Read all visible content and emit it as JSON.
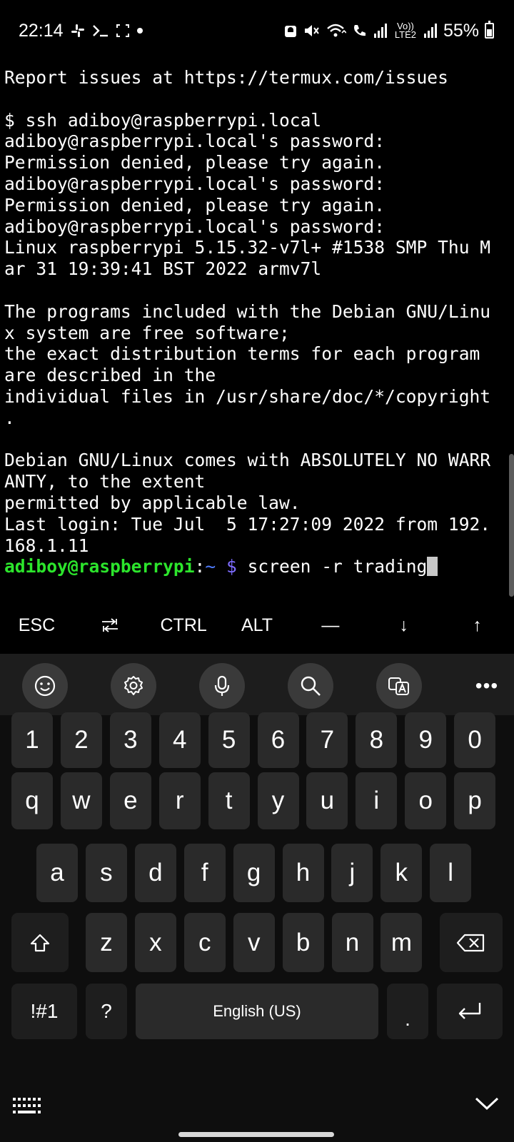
{
  "status_bar": {
    "time": "22:14",
    "left_icons": [
      "slack-icon",
      "terminal-icon",
      "screenshot-icon",
      "dot-icon"
    ],
    "right_icons": [
      "lock-icon",
      "mute-icon",
      "wifi-icon",
      "wifi-calling-icon",
      "signal-icon",
      "signal-icon-2"
    ],
    "volte": "Vo)) LTE2",
    "battery": "55%",
    "battery_level": 0.55
  },
  "terminal": {
    "lines": [
      "Report issues at https://termux.com/issues",
      "",
      "$ ssh adiboy@raspberrypi.local",
      "adiboy@raspberrypi.local's password:",
      "Permission denied, please try again.",
      "adiboy@raspberrypi.local's password:",
      "Permission denied, please try again.",
      "adiboy@raspberrypi.local's password:",
      "Linux raspberrypi 5.15.32-v7l+ #1538 SMP Thu M",
      "ar 31 19:39:41 BST 2022 armv7l",
      "",
      "The programs included with the Debian GNU/Linu",
      "x system are free software;",
      "the exact distribution terms for each program",
      "are described in the",
      "individual files in /usr/share/doc/*/copyright",
      ".",
      "",
      "Debian GNU/Linux comes with ABSOLUTELY NO WARR",
      "ANTY, to the extent",
      "permitted by applicable law.",
      "Last login: Tue Jul  5 17:27:09 2022 from 192.",
      "168.1.11"
    ],
    "prompt_user": "adiboy@raspberrypi",
    "prompt_sep": ":",
    "prompt_path": "~",
    "prompt_symbol": "$",
    "command": "screen -r trading"
  },
  "extra_keys": [
    "ESC",
    "⭾",
    "CTRL",
    "ALT",
    "—",
    "↓",
    "↑"
  ],
  "keyboard": {
    "toolbar_icons": [
      "emoji-icon",
      "settings-icon",
      "microphone-icon",
      "search-icon",
      "translate-icon",
      "more-icon"
    ],
    "more_label": "•••",
    "rows": [
      [
        "1",
        "2",
        "3",
        "4",
        "5",
        "6",
        "7",
        "8",
        "9",
        "0"
      ],
      [
        "q",
        "w",
        "e",
        "r",
        "t",
        "y",
        "u",
        "i",
        "o",
        "p"
      ],
      [
        "a",
        "s",
        "d",
        "f",
        "g",
        "h",
        "j",
        "k",
        "l"
      ],
      [
        "z",
        "x",
        "c",
        "v",
        "b",
        "n",
        "m"
      ]
    ],
    "symbols_label": "!#1",
    "question_label": "?",
    "space_label": "English (US)",
    "period_label": ".",
    "shift_icon": "shift-icon",
    "backspace_icon": "backspace-icon",
    "enter_icon": "enter-icon",
    "keyboard_switch_icon": "keyboard-icon",
    "hide_icon": "chevron-down-icon"
  }
}
